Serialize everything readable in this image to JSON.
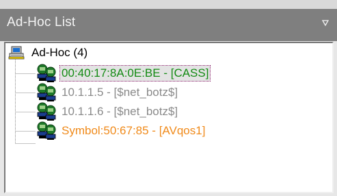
{
  "panel": {
    "title": "Ad-Hoc List",
    "menu_icon": "dropdown-triangle-icon"
  },
  "tree": {
    "root": {
      "icon": "computer-network-icon",
      "label": "Ad-Hoc (4)"
    },
    "nodes": [
      {
        "icon": "network-peer-icon",
        "label": "00:40:17:8A:0E:BE - [CASS]",
        "color": "#128a12",
        "selected": true
      },
      {
        "icon": "network-peer-icon",
        "label": "10.1.1.5 - [$net_botz$]",
        "color": "#8a8a8a",
        "selected": false
      },
      {
        "icon": "network-peer-icon",
        "label": "10.1.1.6 - [$net_botz$]",
        "color": "#8a8a8a",
        "selected": false
      },
      {
        "icon": "network-peer-icon",
        "label": "Symbol:50:67:85 - [AVqos1]",
        "color": "#f08a1a",
        "selected": false
      }
    ]
  }
}
